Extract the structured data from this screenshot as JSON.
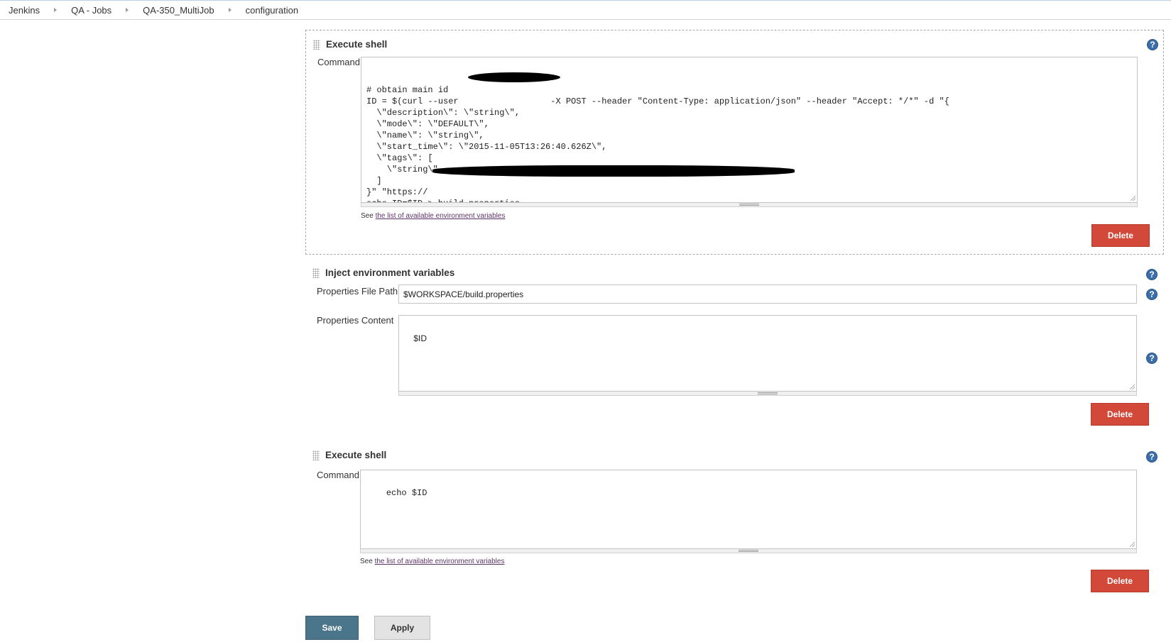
{
  "breadcrumb": [
    "Jenkins",
    "QA - Jobs",
    "QA-350_MultiJob",
    "configuration"
  ],
  "sections": {
    "shell1": {
      "title": "Execute shell",
      "command_label": "Command",
      "command_lines": [
        "# obtain main id",
        "ID = $(curl --user                  -X POST --header \"Content-Type: application/json\" --header \"Accept: */*\" -d \"{",
        "  \\\"description\\\": \\\"string\\\",",
        "  \\\"mode\\\": \\\"DEFAULT\\\",",
        "  \\\"name\\\": \\\"string\\\",",
        "  \\\"start_time\\\": \\\"2015-11-05T13:26:40.626Z\\\",",
        "  \\\"tags\\\": [",
        "    \\\"string\\\"",
        "  ]",
        "}\" \"https://",
        "echo ID=$ID > build.properties"
      ],
      "see_prefix": "See",
      "see_link": "the list of available environment variables",
      "delete_label": "Delete"
    },
    "inject": {
      "title": "Inject environment variables",
      "file_path_label": "Properties File Path",
      "file_path_value": "$WORKSPACE/build.properties",
      "content_label": "Properties Content",
      "content_value": "$ID",
      "delete_label": "Delete"
    },
    "shell2": {
      "title": "Execute shell",
      "command_label": "Command",
      "command_value": "echo $ID",
      "see_prefix": "See",
      "see_link": "the list of available environment variables",
      "delete_label": "Delete"
    }
  },
  "actions": {
    "save_label": "Save",
    "apply_label": "Apply"
  },
  "help_glyph": "?",
  "colors": {
    "delete": "#d24939",
    "save": "#4b758b",
    "apply": "#e3e3e3",
    "link": "#5c3566",
    "help": "#3b6ea8"
  }
}
